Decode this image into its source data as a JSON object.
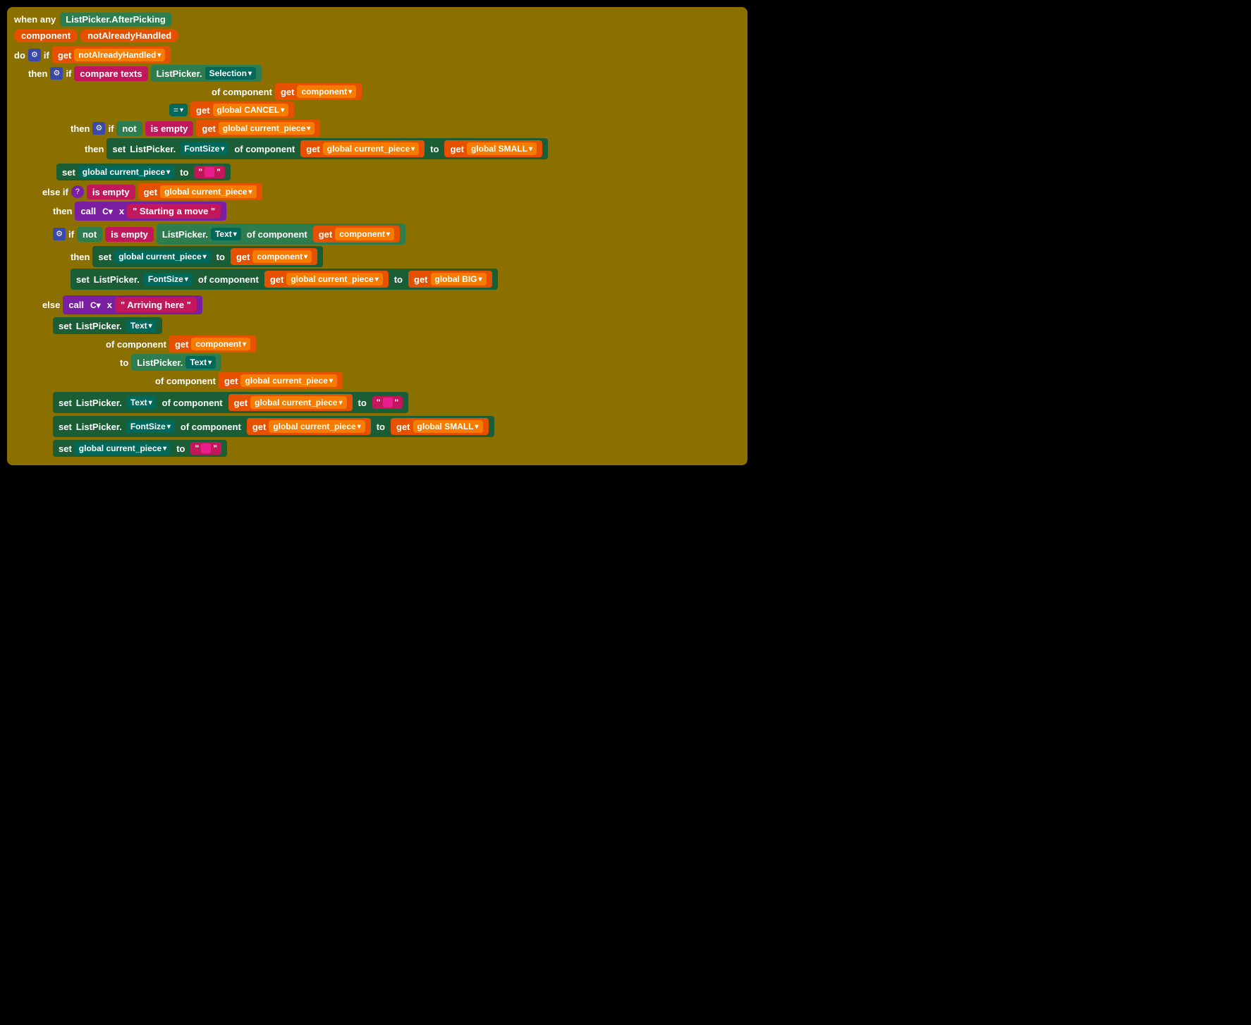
{
  "header": {
    "when_label": "when any",
    "event_name": "ListPicker.AfterPicking",
    "param1": "component",
    "param2": "notAlreadyHandled",
    "do_label": "do"
  },
  "blocks": {
    "if_label": "if",
    "then_label": "then",
    "else_label": "else",
    "else_if_label": "else if",
    "not_label": "not",
    "is_empty_label": "is empty",
    "compare_texts_label": "compare texts",
    "set_label": "set",
    "get_label": "get",
    "to_label": "to",
    "of_component_label": "of component",
    "call_label": "call",
    "x_label": "x",
    "equals_label": "=",
    "get_notAlreadyHandled": "notAlreadyHandled",
    "listpicker_selection": "ListPicker.",
    "selection_dropdown": "Selection",
    "of_component2": "of component",
    "get_component": "component",
    "get_global_cancel": "global CANCEL",
    "get_global_current_piece": "global current_piece",
    "fontsize_dropdown": "FontSize",
    "get_global_current_piece2": "global current_piece",
    "get_global_small": "global SMALL",
    "set_global_current_piece": "global current_piece",
    "is_empty2": "is empty",
    "get_global_current_piece3": "global current_piece",
    "starting_move_text": "\" Starting a move \"",
    "listpicker_text": "ListPicker.",
    "text_dropdown": "Text",
    "of_component3": "of component",
    "get_component2": "component",
    "set_global_current_piece2": "global current_piece",
    "get_component3": "component",
    "fontsize_dropdown2": "FontSize",
    "of_component4": "of component",
    "get_global_current_piece4": "global current_piece",
    "get_global_big": "global BIG",
    "arriving_here_text": "\" Arriving here \"",
    "listpicker_text2": "ListPicker.",
    "text_dropdown2": "Text",
    "of_component5": "of component",
    "get_component4": "component",
    "to2_label": "to",
    "listpicker_text3": "ListPicker.",
    "text_dropdown3": "Text",
    "of_component6": "of component",
    "get_global_current_piece5": "global current_piece",
    "listpicker_text4": "ListPicker.",
    "text_dropdown4": "Text",
    "of_component7": "of component",
    "get_global_current_piece6": "global current_piece",
    "fontsize_dropdown3": "FontSize",
    "of_component8": "of component",
    "get_global_current_piece7": "global current_piece",
    "get_global_small2": "global SMALL",
    "set_global_current_piece3": "global current_piece"
  }
}
